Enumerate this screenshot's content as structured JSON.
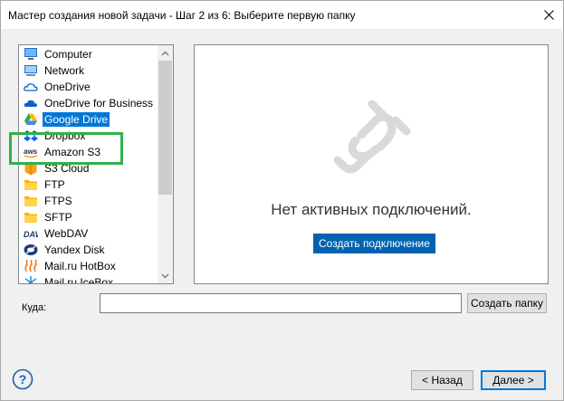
{
  "window": {
    "title": "Мастер создания новой задачи - Шаг 2 из 6: Выберите первую папку"
  },
  "sources": [
    {
      "label": "Computer",
      "icon": "computer-icon",
      "selected": false
    },
    {
      "label": "Network",
      "icon": "network-icon",
      "selected": false
    },
    {
      "label": "OneDrive",
      "icon": "onedrive-icon",
      "selected": false
    },
    {
      "label": "OneDrive for Business",
      "icon": "onedrive-business-icon",
      "selected": false
    },
    {
      "label": "Google Drive",
      "icon": "google-drive-icon",
      "selected": true
    },
    {
      "label": "Dropbox",
      "icon": "dropbox-icon",
      "selected": false
    },
    {
      "label": "Amazon S3",
      "icon": "aws-icon",
      "selected": false
    },
    {
      "label": "S3 Cloud",
      "icon": "s3-cloud-icon",
      "selected": false
    },
    {
      "label": "FTP",
      "icon": "ftp-folder-icon",
      "selected": false
    },
    {
      "label": "FTPS",
      "icon": "ftps-folder-icon",
      "selected": false
    },
    {
      "label": "SFTP",
      "icon": "sftp-folder-icon",
      "selected": false
    },
    {
      "label": "WebDAV",
      "icon": "webdav-icon",
      "selected": false
    },
    {
      "label": "Yandex Disk",
      "icon": "yandex-disk-icon",
      "selected": false
    },
    {
      "label": "Mail.ru HotBox",
      "icon": "mailru-hotbox-icon",
      "selected": false
    },
    {
      "label": "Mail.ru IceBox",
      "icon": "mailru-icebox-icon",
      "selected": false
    }
  ],
  "connections": {
    "empty_text": "Нет активных подключений.",
    "create_button": "Создать подключение"
  },
  "destination": {
    "label": "Куда:",
    "value": "",
    "create_folder_button": "Создать папку"
  },
  "footer": {
    "back_button": "< Назад",
    "next_button": "Далее >"
  },
  "colors": {
    "selection": "#0078d7",
    "highlight_frame": "#2fb24a",
    "primary_button": "#0063b1"
  }
}
